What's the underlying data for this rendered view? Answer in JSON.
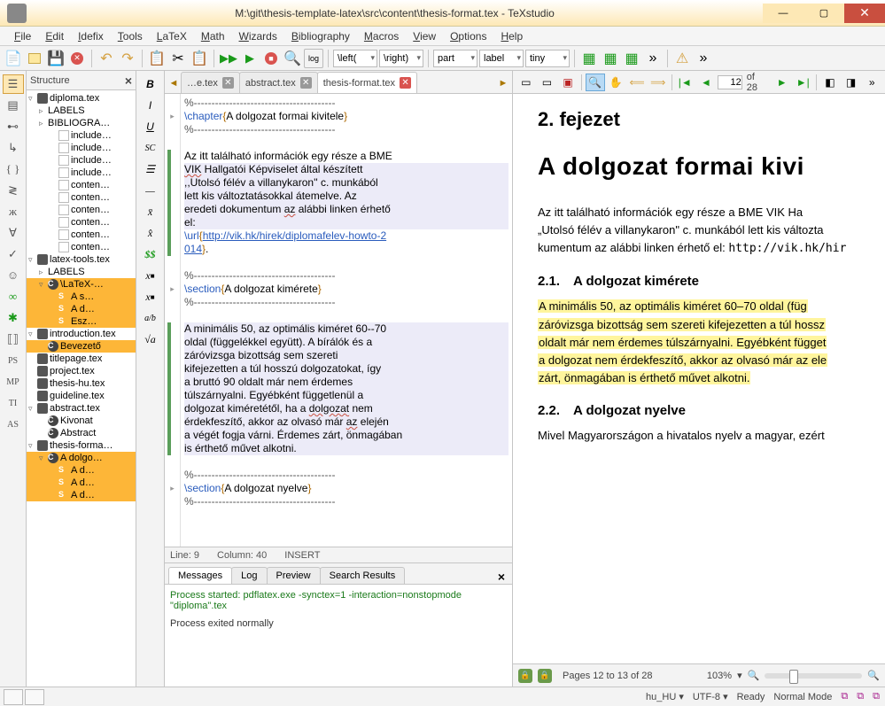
{
  "window": {
    "title": "M:\\git\\thesis-template-latex\\src\\content\\thesis-format.tex - TeXstudio"
  },
  "menubar": [
    "File",
    "Edit",
    "Idefix",
    "Tools",
    "LaTeX",
    "Math",
    "Wizards",
    "Bibliography",
    "Macros",
    "View",
    "Options",
    "Help"
  ],
  "toolbar_selects": {
    "left": "\\left(",
    "right": "\\right)",
    "part": "part",
    "label": "label",
    "tiny": "tiny"
  },
  "structure": {
    "title": "Structure",
    "items": [
      {
        "ind": 0,
        "tog": "▿",
        "ic": "tex",
        "label": "diploma.tex"
      },
      {
        "ind": 1,
        "tog": "▹",
        "ic": "",
        "label": "LABELS"
      },
      {
        "ind": 1,
        "tog": "▹",
        "ic": "",
        "label": "BIBLIOGRA…"
      },
      {
        "ind": 2,
        "tog": "",
        "ic": "doc",
        "label": "include…"
      },
      {
        "ind": 2,
        "tog": "",
        "ic": "doc",
        "label": "include…"
      },
      {
        "ind": 2,
        "tog": "",
        "ic": "doc",
        "label": "include…"
      },
      {
        "ind": 2,
        "tog": "",
        "ic": "doc",
        "label": "include…"
      },
      {
        "ind": 2,
        "tog": "",
        "ic": "doc",
        "label": "conten…"
      },
      {
        "ind": 2,
        "tog": "",
        "ic": "doc",
        "label": "conten…"
      },
      {
        "ind": 2,
        "tog": "",
        "ic": "doc",
        "label": "conten…"
      },
      {
        "ind": 2,
        "tog": "",
        "ic": "doc",
        "label": "conten…"
      },
      {
        "ind": 2,
        "tog": "",
        "ic": "doc",
        "label": "conten…"
      },
      {
        "ind": 2,
        "tog": "",
        "ic": "doc",
        "label": "conten…"
      },
      {
        "ind": 0,
        "tog": "▿",
        "ic": "tex",
        "label": "latex-tools.tex"
      },
      {
        "ind": 1,
        "tog": "▹",
        "ic": "",
        "label": "LABELS"
      },
      {
        "ind": 1,
        "tog": "▿",
        "ic": "cls",
        "label": "\\LaTeX-…",
        "sel": true
      },
      {
        "ind": 2,
        "tog": "",
        "ic": "sec",
        "label": "A s…",
        "sel": true
      },
      {
        "ind": 2,
        "tog": "",
        "ic": "sec",
        "label": "A d…",
        "sel": true
      },
      {
        "ind": 2,
        "tog": "",
        "ic": "sec",
        "label": "Esz…",
        "sel": true
      },
      {
        "ind": 0,
        "tog": "▿",
        "ic": "tex",
        "label": "introduction.tex"
      },
      {
        "ind": 1,
        "tog": "",
        "ic": "cls",
        "label": "Bevezető",
        "sel": true
      },
      {
        "ind": 0,
        "tog": "",
        "ic": "tex",
        "label": "titlepage.tex"
      },
      {
        "ind": 0,
        "tog": "",
        "ic": "tex",
        "label": "project.tex"
      },
      {
        "ind": 0,
        "tog": "",
        "ic": "tex",
        "label": "thesis-hu.tex"
      },
      {
        "ind": 0,
        "tog": "",
        "ic": "tex",
        "label": "guideline.tex"
      },
      {
        "ind": 0,
        "tog": "▿",
        "ic": "tex",
        "label": "abstract.tex"
      },
      {
        "ind": 1,
        "tog": "",
        "ic": "cls",
        "label": "Kivonat"
      },
      {
        "ind": 1,
        "tog": "",
        "ic": "cls",
        "label": "Abstract"
      },
      {
        "ind": 0,
        "tog": "▿",
        "ic": "tex",
        "label": "thesis-forma…"
      },
      {
        "ind": 1,
        "tog": "▿",
        "ic": "cls",
        "label": "A dolgo…",
        "sel": true
      },
      {
        "ind": 2,
        "tog": "",
        "ic": "sec",
        "label": "A d…",
        "sel": true
      },
      {
        "ind": 2,
        "tog": "",
        "ic": "sec",
        "label": "A d…",
        "sel": true
      },
      {
        "ind": 2,
        "tog": "",
        "ic": "sec",
        "label": "A d…",
        "sel": true
      }
    ]
  },
  "tabs": [
    {
      "label": "…e.tex",
      "active": false
    },
    {
      "label": "abstract.tex",
      "active": false
    },
    {
      "label": "thesis-format.tex",
      "active": true
    }
  ],
  "editor": {
    "status": {
      "line": "Line: 9",
      "col": "Column: 40",
      "mode": "INSERT"
    }
  },
  "code_lines": [
    {
      "t": "%----------------------------------------",
      "fold": ""
    },
    {
      "t": "<cmd>\\chapter</cmd><brk>{</brk>A dolgozat formai kivitele<brk>}</brk>",
      "fold": "▸"
    },
    {
      "t": "%----------------------------------------",
      "fold": ""
    },
    {
      "t": "",
      "fold": ""
    },
    {
      "t": "Az itt található információk egy része a BME",
      "fold": "",
      "cb": 1
    },
    {
      "t": "<sq>VIK</sq> Hallgatói Képviselet által készített",
      "cb": 1,
      "hl": true
    },
    {
      "t": ",,Utolsó félév a villanykaron'' c. munkából",
      "cb": 1,
      "hl": true
    },
    {
      "t": "lett kis változtatásokkal átemelve. Az",
      "cb": 1,
      "hl": true
    },
    {
      "t": "eredeti dokumentum <sq>az</sq> alábbi linken érhető",
      "cb": 1,
      "hl": true
    },
    {
      "t": "el:",
      "cb": 1,
      "hl": true
    },
    {
      "t": "<cmd>\\url</cmd><brk>{</brk><url>http://vik.hk/hirek/diplomafelev-howto-2</url>",
      "cb": 1
    },
    {
      "t": "<url>014</url><brk>}</brk>.",
      "cb": 1
    },
    {
      "t": "",
      "fold": ""
    },
    {
      "t": "%----------------------------------------",
      "fold": ""
    },
    {
      "t": "<cmd>\\section</cmd><brk>{</brk>A dolgozat kimérete<brk>}</brk>",
      "fold": "▸"
    },
    {
      "t": "%----------------------------------------",
      "fold": ""
    },
    {
      "t": "",
      "fold": ""
    },
    {
      "t": "A minimális 50, az optimális kiméret 60--70",
      "cb": 1,
      "hl": true
    },
    {
      "t": "oldal (függelékkel együtt). A bírálók és a",
      "cb": 1,
      "hl": true
    },
    {
      "t": "záróvizsga bizottság sem szereti",
      "cb": 1,
      "hl": true
    },
    {
      "t": "kifejezetten a túl hosszú dolgozatokat, így",
      "cb": 1,
      "hl": true
    },
    {
      "t": "a bruttó 90 oldalt már nem érdemes",
      "cb": 1,
      "hl": true
    },
    {
      "t": "túlszárnyalni. Egyébként függetlenül a",
      "cb": 1,
      "hl": true
    },
    {
      "t": "dolgozat kiméretétől, ha a <sq>dolgozat</sq> nem",
      "cb": 1,
      "hl": true
    },
    {
      "t": "érdekfeszítő, akkor az olvasó már <sq>az</sq> elején",
      "cb": 1,
      "hl": true
    },
    {
      "t": "a végét fogja várni. Érdemes zárt, önmagában",
      "cb": 1,
      "hl": true
    },
    {
      "t": "is érthető művet alkotni.",
      "cb": 1,
      "hl": true
    },
    {
      "t": "",
      "fold": ""
    },
    {
      "t": "%----------------------------------------",
      "fold": ""
    },
    {
      "t": "<cmd>\\section</cmd><brk>{</brk>A dolgozat nyelve<brk>}</brk>",
      "fold": "▸"
    },
    {
      "t": "%----------------------------------------",
      "fold": ""
    }
  ],
  "messages": {
    "tabs": [
      "Messages",
      "Log",
      "Preview",
      "Search Results"
    ],
    "active": 0,
    "line1": "Process started: pdflatex.exe -synctex=1 -interaction=nonstopmode \"diploma\".tex",
    "line2": "Process exited normally"
  },
  "pdf_toolbar": {
    "page": "12",
    "of": "of 28"
  },
  "pdf": {
    "chapter": "2. fejezet",
    "title": "A dolgozat formai kivi",
    "para1a": "Az itt található információk egy része a BME VIK Ha",
    "para1b": "„Utolsó félév a villanykaron\" c. munkából lett kis változta",
    "para1c": "kumentum az alábbi linken érhető el: ",
    "para1url": "http://vik.hk/hir",
    "h21": "2.1. A dolgozat kimérete",
    "p2a": "A minimális 50, az optimális kiméret 60–70 oldal (füg",
    "p2b": "záróvizsga bizottság sem szereti kifejezetten a túl hossz",
    "p2c": "oldalt már nem érdemes túlszárnyalni. Egyébként függet",
    "p2d": "a dolgozat nem érdekfeszítő, akkor az olvasó már az ele",
    "p2e": "zárt, önmagában is érthető művet alkotni.",
    "h22": "2.2. A dolgozat nyelve",
    "p3": "Mivel Magyarországon a hivatalos nyelv a magyar, ezért"
  },
  "pdf_status": {
    "pages": "Pages 12 to 13 of 28",
    "zoom": "103%"
  },
  "bottombar": {
    "lang": "hu_HU ▾",
    "enc": "UTF-8 ▾",
    "state": "Ready",
    "mode": "Normal Mode"
  }
}
